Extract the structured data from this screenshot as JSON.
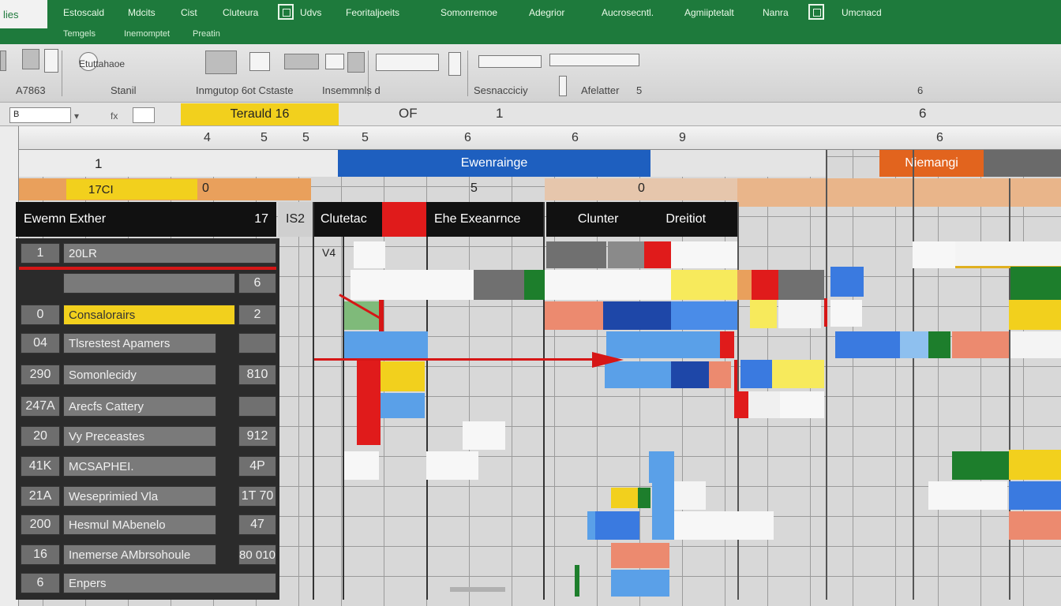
{
  "ribbon": {
    "file_label": "lies",
    "tabs": [
      "Estoscald",
      "Mdcits",
      "Cist",
      "Cluteura",
      "Udvs",
      "Feoritaljoeits",
      "Somonremoe",
      "Adegrior",
      "Aucrosecntl.",
      "Agmiiptetalt",
      "Nanra",
      "Umcnacd"
    ],
    "subtabs": [
      "Temgels",
      "Inemomptet",
      "Preatin"
    ]
  },
  "toolbar": {
    "labels": [
      "Etuttahaoe",
      "Stanil",
      "Inmgutop 6ot Cstaste",
      "Insemmnls d",
      "Sesnacciciy",
      "Afelatter",
      "5",
      "6",
      "A7863"
    ]
  },
  "formula_bar": {
    "namebox": "B",
    "fx": "fx",
    "yellow_text": "Terauld 16",
    "text1": "OF",
    "text2": "1",
    "text3": "6"
  },
  "column_numbers": [
    "4",
    "5",
    "5",
    "5",
    "6",
    "9",
    "6",
    "6"
  ],
  "header_bands": {
    "row1_num": "1",
    "blue_label": "Ewenrainge",
    "orange_label": "Niemangi",
    "row2_left": "17CI",
    "row2_num": "0",
    "row2_mid": "5",
    "row2_right": "0"
  },
  "dark_headers": {
    "left_title": "Ewemn Exther",
    "left_num": "17",
    "col2": "IS2",
    "col3": "Clutetac",
    "col4": "Ehe Exeanrnce",
    "col5": "Clunter",
    "col6": "Dreitiot"
  },
  "left_rows": [
    {
      "num": "1",
      "label": "20LR",
      "value": ""
    },
    {
      "num": "",
      "label": "",
      "value": "6"
    },
    {
      "num": "0",
      "label": "Consalorairs",
      "value": "2"
    },
    {
      "num": "04",
      "label": "Tlsrestest Apamers",
      "value": ""
    },
    {
      "num": "290",
      "label": "Somonlecidy",
      "value": "810"
    },
    {
      "num": "247A",
      "label": "Arecfs Cattery",
      "value": ""
    },
    {
      "num": "20",
      "label": "Vy Preceastes",
      "value": "912"
    },
    {
      "num": "41K",
      "label": "MCSAPHEI.",
      "value": "4P"
    },
    {
      "num": "21A",
      "label": "Weseprimied Vla",
      "value": "1T 70"
    },
    {
      "num": "200",
      "label": "Hesmul MAbenelo",
      "value": "47"
    },
    {
      "num": "16",
      "label": "Inemerse AMbrsohoule",
      "value": "80 010"
    },
    {
      "num": "6",
      "label": "Enpers",
      "value": ""
    }
  ],
  "grid_cell_text": "V4",
  "colors": {
    "ribbon": "#1e7a3c",
    "red": "#e01b1b",
    "blue": "#1e5fbf",
    "light_blue": "#5aa0e8",
    "yellow": "#f2d01d",
    "green": "#1d7e2c",
    "orange": "#e2641e",
    "salmon": "#ec8a6f"
  }
}
